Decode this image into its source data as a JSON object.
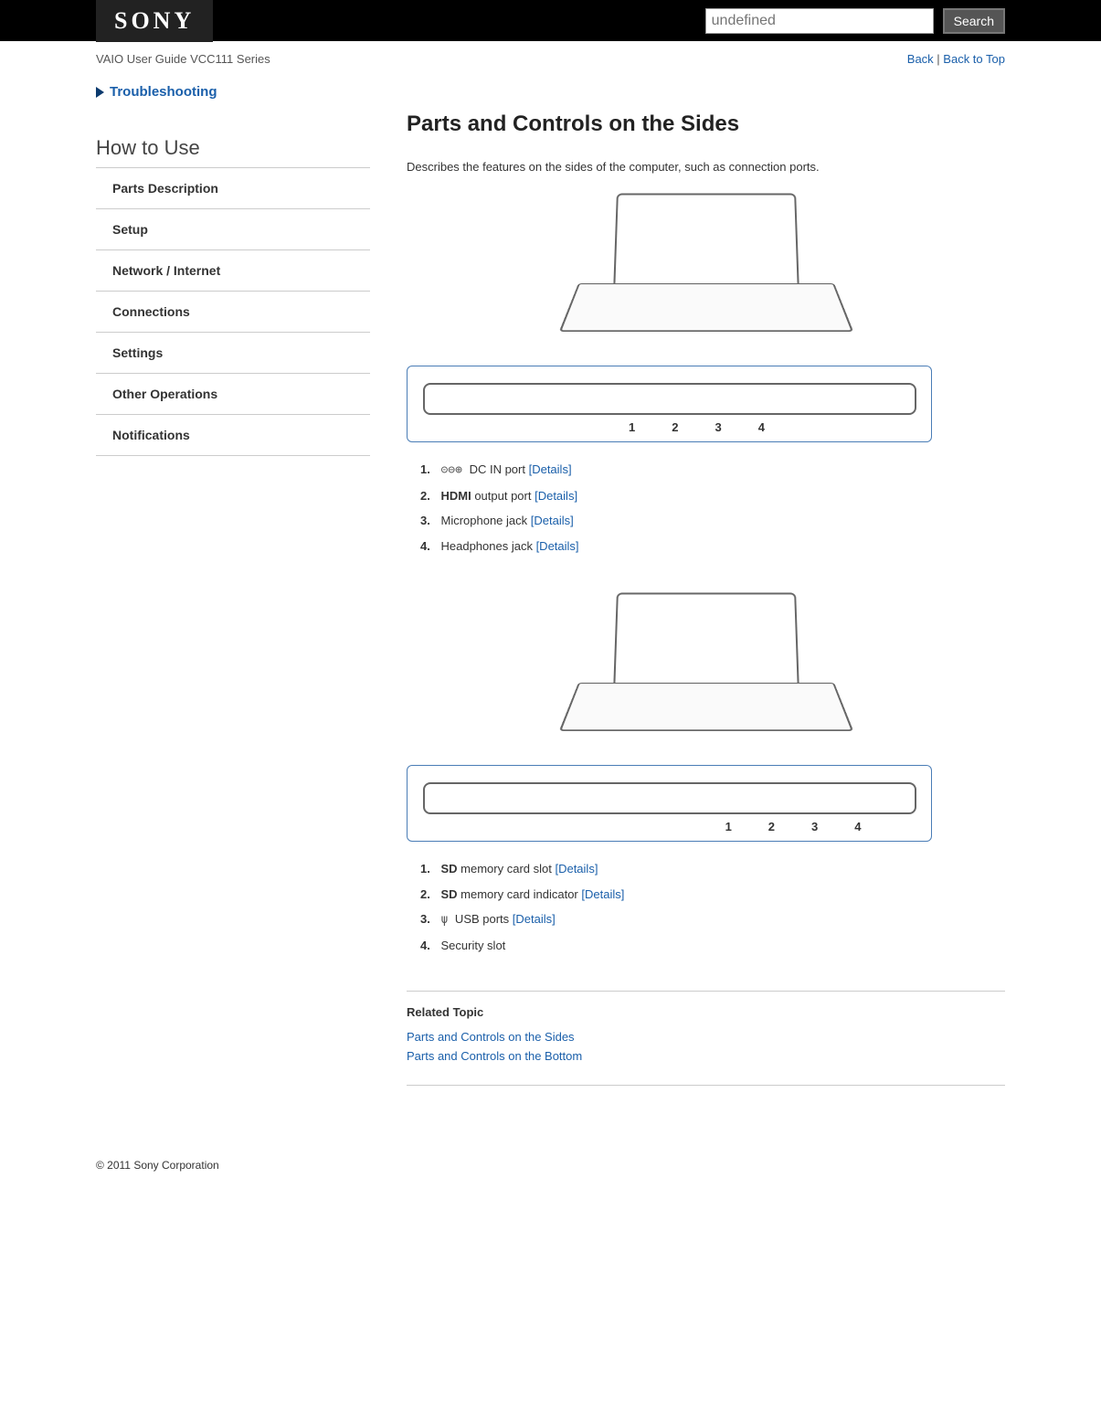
{
  "brand": "SONY",
  "search": {
    "placeholder": "undefined",
    "button": "Search"
  },
  "subheader": {
    "title": "VAIO User Guide VCC111 Series",
    "back": "Back",
    "sep": " | ",
    "top": "Back to Top"
  },
  "sidebar": {
    "troubleshoot": "Troubleshooting",
    "section": "How to Use",
    "items": [
      "Parts Description",
      "Setup",
      "Network / Internet",
      "Connections",
      "Settings",
      "Other Operations",
      "Notifications"
    ]
  },
  "main": {
    "title": "Parts and Controls on the Sides",
    "intro": "Describes the features on the sides of the computer, such as connection ports.",
    "fig1": {
      "marks": [
        "1",
        "2",
        "3",
        "4"
      ],
      "list": [
        {
          "glyph": "⊝⊖⊕",
          "pre": "",
          "bold": "",
          "text": " DC IN port ",
          "link": "[Details]"
        },
        {
          "glyph": "",
          "pre": "",
          "bold": "HDMI",
          "text": " output port ",
          "link": "[Details]"
        },
        {
          "glyph": "",
          "pre": "",
          "bold": "",
          "text": "Microphone jack ",
          "link": "[Details]"
        },
        {
          "glyph": "",
          "pre": "",
          "bold": "",
          "text": "Headphones jack ",
          "link": "[Details]"
        }
      ]
    },
    "fig2": {
      "marks": [
        "1",
        "2",
        "3",
        "4"
      ],
      "list": [
        {
          "glyph": "",
          "bold": "SD",
          "text": " memory card slot ",
          "link": "[Details]"
        },
        {
          "glyph": "",
          "bold": "SD",
          "text": " memory card indicator ",
          "link": "[Details]"
        },
        {
          "glyph": "ψ",
          "bold": "",
          "text": " USB ports ",
          "link": "[Details]"
        },
        {
          "glyph": "",
          "bold": "",
          "text": "Security slot",
          "link": ""
        }
      ]
    },
    "related": {
      "title": "Related Topic",
      "links": [
        "Parts and Controls on the Sides",
        "Parts and Controls on the Bottom"
      ]
    }
  },
  "footer": "© 2011 Sony Corporation"
}
